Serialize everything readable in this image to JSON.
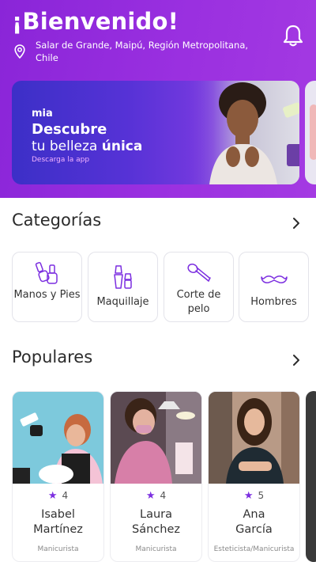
{
  "header": {
    "title": "¡Bienvenido!",
    "address": "Salar de Grande, Maipú, Región Metropolitana, Chile"
  },
  "banner": {
    "logo": "mia",
    "line1": "Descubre",
    "line2_prefix": "tu belleza",
    "line2_emphasis": "única",
    "cta": "Descarga la app"
  },
  "categories": {
    "title": "Categorías",
    "items": [
      {
        "label": "Manos y Pies",
        "icon": "nail-polish-icon"
      },
      {
        "label": "Maquillaje",
        "icon": "makeup-brush-icon"
      },
      {
        "label": "Corte de pelo",
        "icon": "hair-dryer-icon"
      },
      {
        "label": "Hombres",
        "icon": "mustache-icon"
      }
    ]
  },
  "popular": {
    "title": "Populares",
    "items": [
      {
        "first": "Isabel",
        "last": "Martínez",
        "rating": "4",
        "role": "Manicurista"
      },
      {
        "first": "Laura",
        "last": "Sánchez",
        "rating": "4",
        "role": "Manicurista"
      },
      {
        "first": "Ana",
        "last": "García",
        "rating": "5",
        "role": "Esteticista/Manicurista"
      }
    ]
  },
  "colors": {
    "primary": "#8a25d8",
    "accent_star": "#7c2fe0"
  }
}
